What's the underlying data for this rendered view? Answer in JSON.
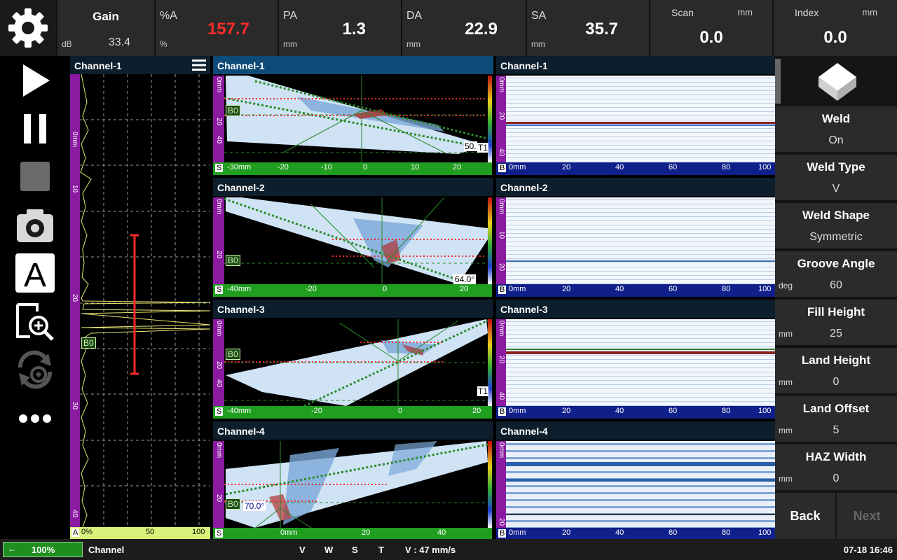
{
  "top": {
    "gain": {
      "label": "Gain",
      "unit": "dB",
      "value": "33.4"
    },
    "pa_pct": {
      "label": "%A",
      "unit": "%",
      "value": "157.7"
    },
    "pa": {
      "label": "PA",
      "unit": "mm",
      "value": "1.3"
    },
    "da": {
      "label": "DA",
      "unit": "mm",
      "value": "22.9"
    },
    "sa": {
      "label": "SA",
      "unit": "mm",
      "value": "35.7"
    },
    "scan": {
      "label": "Scan",
      "unit": "mm",
      "value": "0.0"
    },
    "index": {
      "label": "Index",
      "unit": "mm",
      "value": "0.0"
    }
  },
  "ascan": {
    "title": "Channel-1",
    "gate": "B0",
    "depth_ticks": [
      "0mm",
      "10",
      "20",
      "30",
      "40"
    ],
    "amp_ticks": [
      "A",
      "0%",
      "50",
      "100"
    ]
  },
  "sscans": [
    {
      "title": "Channel-1",
      "axis": [
        "S",
        "-30mm",
        "-20",
        "-10",
        "0",
        "10",
        "20"
      ],
      "gate": "B0",
      "angle": "50.",
      "tag": "T1",
      "depth": [
        "0mm",
        "20",
        "40"
      ]
    },
    {
      "title": "Channel-2",
      "axis": [
        "S",
        "-40mm",
        "-20",
        "0",
        "20"
      ],
      "gate": "B0",
      "angle": "64.0°",
      "tag": "",
      "depth": [
        "0mm",
        "20"
      ]
    },
    {
      "title": "Channel-3",
      "axis": [
        "S",
        "-40mm",
        "-20",
        "0",
        "20"
      ],
      "gate": "B0",
      "angle": "",
      "tag": "T1",
      "depth": [
        "0mm",
        "20",
        "40"
      ]
    },
    {
      "title": "Channel-4",
      "axis": [
        "S",
        "0mm",
        "20",
        "40"
      ],
      "gate": "B0",
      "angle": "70.0°",
      "tag": "",
      "depth": [
        "0mm",
        "20"
      ]
    }
  ],
  "bscans": [
    {
      "title": "Channel-1",
      "axis": [
        "B",
        "0mm",
        "20",
        "40",
        "60",
        "80",
        "100"
      ],
      "depth": [
        "0mm",
        "20",
        "40"
      ]
    },
    {
      "title": "Channel-2",
      "axis": [
        "B",
        "0mm",
        "20",
        "40",
        "60",
        "80",
        "100"
      ],
      "depth": [
        "0mm",
        "10",
        "20"
      ]
    },
    {
      "title": "Channel-3",
      "axis": [
        "B",
        "0mm",
        "20",
        "40",
        "60",
        "80",
        "100"
      ],
      "depth": [
        "0mm",
        "20",
        "40"
      ]
    },
    {
      "title": "Channel-4",
      "axis": [
        "B",
        "0mm",
        "20",
        "40",
        "60",
        "80",
        "100"
      ],
      "depth": [
        "0mm",
        "20"
      ]
    }
  ],
  "settings": [
    {
      "title": "Weld",
      "value": "On",
      "unit": ""
    },
    {
      "title": "Weld Type",
      "value": "V",
      "unit": ""
    },
    {
      "title": "Weld Shape",
      "value": "Symmetric",
      "unit": ""
    },
    {
      "title": "Groove Angle",
      "value": "60",
      "unit": "deg"
    },
    {
      "title": "Fill Height",
      "value": "25",
      "unit": "mm"
    },
    {
      "title": "Land Height",
      "value": "0",
      "unit": "mm"
    },
    {
      "title": "Land Offset",
      "value": "5",
      "unit": "mm"
    },
    {
      "title": "HAZ Width",
      "value": "0",
      "unit": "mm"
    }
  ],
  "nav": {
    "back": "Back",
    "next": "Next"
  },
  "status": {
    "battery": "100%",
    "mode": "Channel",
    "v": "V",
    "w": "W",
    "s": "S",
    "t": "T",
    "speed": "V : 47 mm/s",
    "datetime": "07-18 16:46"
  },
  "colors": {
    "accent_red": "#ff2a2a",
    "ruler_green": "#1f9e1f",
    "ruler_blue": "#10208a",
    "depth_purple": "#8a1aa0",
    "ascan_yellow": "#e8e870"
  }
}
